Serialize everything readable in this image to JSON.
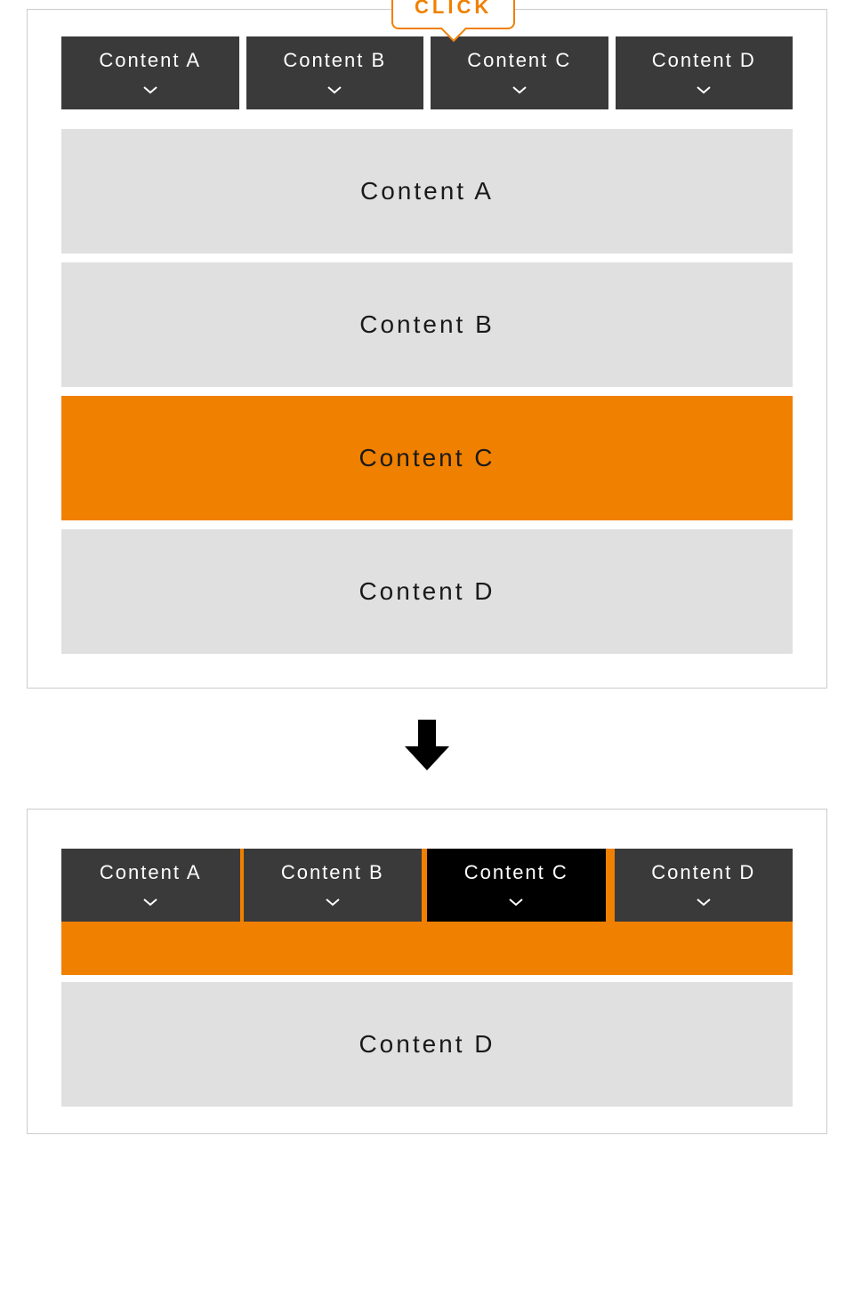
{
  "click_label": "CLICK",
  "colors": {
    "accent": "#f08000",
    "tab_bg": "#3a3a3a",
    "tab_active_bg": "#000000",
    "content_bg": "#e0e0e0"
  },
  "panel1": {
    "tabs": [
      {
        "label": "Content A"
      },
      {
        "label": "Content B"
      },
      {
        "label": "Content C"
      },
      {
        "label": "Content D"
      }
    ],
    "blocks": [
      {
        "label": "Content A",
        "highlight": false
      },
      {
        "label": "Content B",
        "highlight": false
      },
      {
        "label": "Content C",
        "highlight": true
      },
      {
        "label": "Content D",
        "highlight": false
      }
    ]
  },
  "panel2": {
    "tabs": [
      {
        "label": "Content A",
        "active": false
      },
      {
        "label": "Content B",
        "active": false
      },
      {
        "label": "Content C",
        "active": true
      },
      {
        "label": "Content D",
        "active": false
      }
    ],
    "visible_block": {
      "label": "Content D"
    }
  }
}
